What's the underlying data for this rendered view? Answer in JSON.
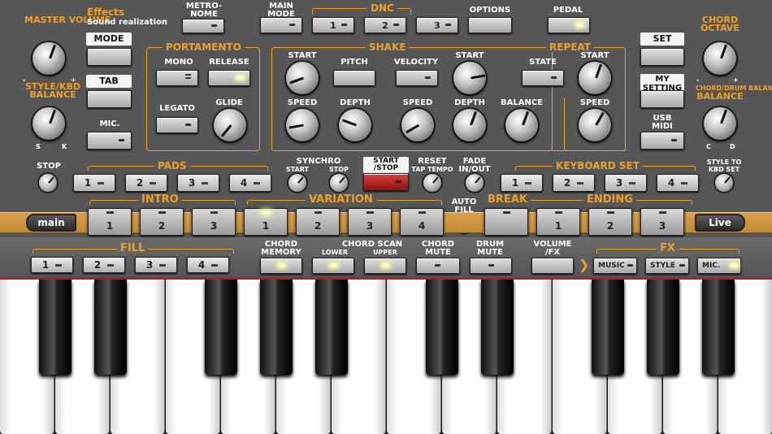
{
  "header": {
    "effects_title": "Effects",
    "effects_sub": "Sound realization"
  },
  "left": {
    "master_volume": "MASTER VOLUME",
    "balance": "STYLE/KBD BALANCE",
    "s": "S",
    "k": "K",
    "minus": "-",
    "plus": "+",
    "mode": "MODE",
    "tab": "TAB",
    "mic": "MIC."
  },
  "top": {
    "metronome": "METRO-NOME",
    "main_mode": "MAIN MODE",
    "dnc": "DNC",
    "options": "OPTIONS",
    "pedal": "PEDAL",
    "dnc_1": "1",
    "dnc_2": "2",
    "dnc_3": "3"
  },
  "portamento": {
    "title": "PORTAMENTO",
    "mono": "MONO",
    "release": "RELEASE",
    "legato": "LEGATO",
    "glide": "GLIDE"
  },
  "shake": {
    "title": "SHAKE",
    "start": "START",
    "pitch": "PITCH",
    "speed": "SPEED",
    "depth": "DEPTH",
    "velocity": "VELOCITY",
    "start2": "START",
    "speed2": "SPEED",
    "depth2": "DEPTH",
    "balance": "BALANCE"
  },
  "repeat": {
    "title": "REPEAT",
    "state": "STATE",
    "start": "START",
    "speed": "SPEED"
  },
  "right": {
    "set": "SET",
    "my_setting": "MY SETTING",
    "usb_midi": "USB MIDI",
    "chord_octave": "CHORD OCTAVE",
    "chord_drum_balance": "CHORD/DRUM BALANCE",
    "balance": "BALANCE",
    "c": "C",
    "d": "D",
    "minus": "-",
    "plus": "+"
  },
  "pads": {
    "stop": "STOP",
    "title": "PADS",
    "items": [
      "1",
      "2",
      "3",
      "4"
    ],
    "synchro": "SYNCHRO",
    "sync_start": "START",
    "sync_stop": "STOP",
    "start_stop": "START /STOP",
    "reset": "RESET",
    "tap_tempo": "TAP TEMPO",
    "fade": "FADE IN/OUT"
  },
  "keyboard_set": {
    "title": "KEYBOARD SET",
    "items": [
      "1",
      "2",
      "3",
      "4"
    ],
    "style_to_kbd": "STYLE TO KBD SET"
  },
  "sections": {
    "intro": "INTRO",
    "variation": "VARIATION",
    "auto_fill": "AUTO FILL",
    "break": "BREAK",
    "ending": "ENDING",
    "intro_items": [
      "1",
      "2",
      "3"
    ],
    "variation_items": [
      "1",
      "2",
      "3",
      "4"
    ],
    "ending_items": [
      "1",
      "2",
      "3"
    ]
  },
  "nav": {
    "main": "main",
    "live": "Live"
  },
  "bottom": {
    "fill": "FILL",
    "fill_items": [
      "1",
      "2",
      "3",
      "4"
    ],
    "chord_memory": "CHORD MEMORY",
    "chord_scan": "CHORD SCAN",
    "lower": "LOWER",
    "upper": "UPPER",
    "chord_mute": "CHORD MUTE",
    "drum_mute": "DRUM MUTE",
    "volume_fx": "VOLUME /FX",
    "fx": "FX",
    "music": "MUSIC",
    "style": "STYLE",
    "mic": "MIC."
  },
  "colors": {
    "accent": "#f0a020",
    "stripe": "#d9a04a",
    "red_button": "#c02020"
  }
}
